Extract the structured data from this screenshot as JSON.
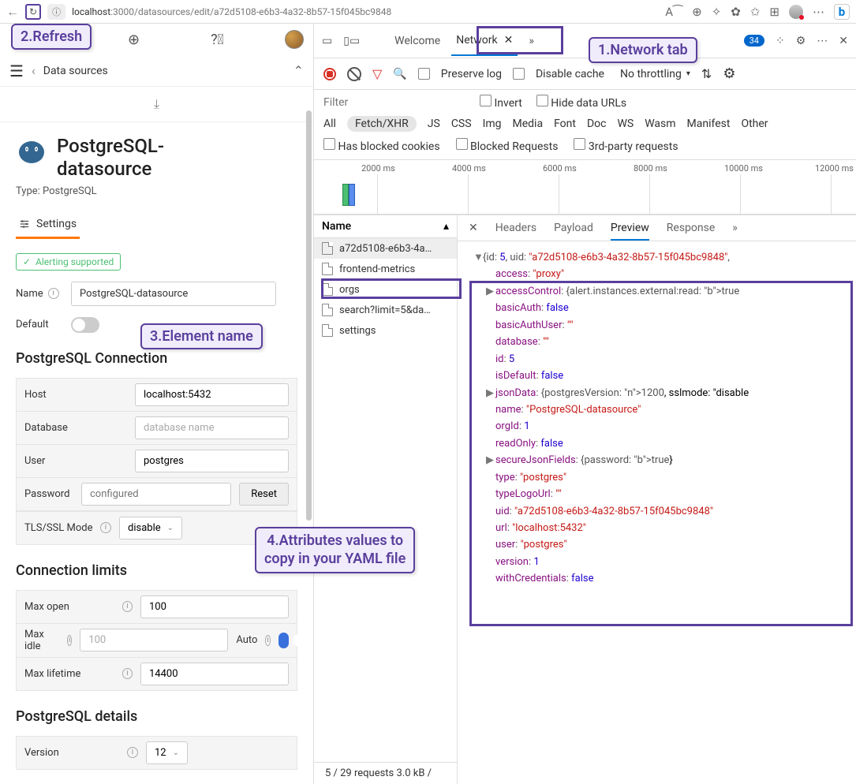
{
  "browser": {
    "url_host": "localhost",
    "url_path": ":3000/datasources/edit/a72d5108-e6b3-4a32-8b57-15f045bc9848",
    "info_icon": "ⓘ"
  },
  "annotations": {
    "refresh": "2.Refresh",
    "network": "1.Network tab",
    "element": "3.Element name",
    "attrs_l1": "4.Attributes values to",
    "attrs_l2": "copy in your YAML file"
  },
  "grafana": {
    "breadcrumb": "Data sources",
    "title1": "PostgreSQL-",
    "title2": "datasource",
    "type": "Type: PostgreSQL",
    "settings_tab": "Settings",
    "alerting": "Alerting supported",
    "name_label": "Name",
    "name_value": "PostgreSQL-datasource",
    "default_label": "Default",
    "conn_header": "PostgreSQL Connection",
    "host_label": "Host",
    "host_value": "localhost:5432",
    "db_label": "Database",
    "db_placeholder": "database name",
    "user_label": "User",
    "user_value": "postgres",
    "pw_label": "Password",
    "pw_placeholder": "configured",
    "reset": "Reset",
    "tls_label": "TLS/SSL Mode",
    "tls_value": "disable",
    "limits_header": "Connection limits",
    "maxopen_label": "Max open",
    "maxopen_value": "100",
    "maxidle_label": "Max idle",
    "maxidle_value": "100",
    "auto_label": "Auto",
    "maxlife_label": "Max lifetime",
    "maxlife_value": "14400",
    "details_header": "PostgreSQL details",
    "version_label": "Version",
    "version_value": "12"
  },
  "devtools": {
    "welcome": "Welcome",
    "network": "Network",
    "badge": "34",
    "preserve": "Preserve log",
    "disablecache": "Disable cache",
    "throttle": "No throttling",
    "filter_placeholder": "Filter",
    "invert": "Invert",
    "hidedata": "Hide data URLs",
    "types": [
      "All",
      "Fetch/XHR",
      "JS",
      "CSS",
      "Img",
      "Media",
      "Font",
      "Doc",
      "WS",
      "Wasm",
      "Manifest",
      "Other"
    ],
    "blocked_cookies": "Has blocked cookies",
    "blocked_req": "Blocked Requests",
    "thirdparty": "3rd-party requests",
    "ticks": [
      "2000 ms",
      "4000 ms",
      "6000 ms",
      "8000 ms",
      "10000 ms",
      "12000 ms"
    ],
    "name_header": "Name",
    "requests": [
      "a72d5108-e6b3-4a…",
      "frontend-metrics",
      "orgs",
      "search?limit=5&da…",
      "settings"
    ],
    "detail_tabs": {
      "headers": "Headers",
      "payload": "Payload",
      "preview": "Preview",
      "response": "Response"
    },
    "status": "5 / 29 requests  3.0 kB / "
  },
  "json": {
    "top": "{id: 5, uid: \"a72d5108-e6b3-4a32-8b57-15f045bc9848\",",
    "lines": [
      {
        "k": "access",
        "v": "\"proxy\"",
        "t": "s"
      },
      {
        "k": "accessControl",
        "v": "{alert.instances.external:read: true",
        "t": "p",
        "exp": true
      },
      {
        "k": "basicAuth",
        "v": "false",
        "t": "b"
      },
      {
        "k": "basicAuthUser",
        "v": "\"\"",
        "t": "s"
      },
      {
        "k": "database",
        "v": "\"\"",
        "t": "s"
      },
      {
        "k": "id",
        "v": "5",
        "t": "n"
      },
      {
        "k": "isDefault",
        "v": "false",
        "t": "b"
      },
      {
        "k": "jsonData",
        "v": "{postgresVersion: 1200, sslmode: \"disable",
        "t": "p",
        "exp": true
      },
      {
        "k": "name",
        "v": "\"PostgreSQL-datasource\"",
        "t": "s"
      },
      {
        "k": "orgId",
        "v": "1",
        "t": "n"
      },
      {
        "k": "readOnly",
        "v": "false",
        "t": "b"
      },
      {
        "k": "secureJsonFields",
        "v": "{password: true}",
        "t": "p",
        "exp": true
      },
      {
        "k": "type",
        "v": "\"postgres\"",
        "t": "s"
      },
      {
        "k": "typeLogoUrl",
        "v": "\"\"",
        "t": "s"
      },
      {
        "k": "uid",
        "v": "\"a72d5108-e6b3-4a32-8b57-15f045bc9848\"",
        "t": "s"
      },
      {
        "k": "url",
        "v": "\"localhost:5432\"",
        "t": "s"
      },
      {
        "k": "user",
        "v": "\"postgres\"",
        "t": "s"
      },
      {
        "k": "version",
        "v": "1",
        "t": "n"
      },
      {
        "k": "withCredentials",
        "v": "false",
        "t": "b"
      }
    ]
  }
}
